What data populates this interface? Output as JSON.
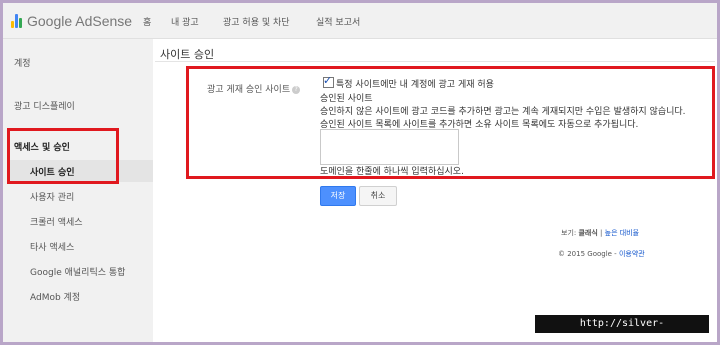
{
  "header": {
    "logo_text": "Google AdSense",
    "nav": [
      "홈",
      "내 광고",
      "광고 허용 및 차단",
      "실적 보고서"
    ]
  },
  "sidebar": {
    "items": [
      "계정",
      "광고 디스플레이",
      "액세스 및 승인",
      "사이트 승인",
      "사용자 관리",
      "크롤러 액세스",
      "타사 액세스",
      "Google 애널리틱스 통합",
      "AdMob 계정"
    ]
  },
  "main": {
    "section_title": "사이트 승인",
    "setting_label": "광고 게재 승인 사이트",
    "help_glyph": "?",
    "checkbox_label": "특정 사이트에만 내 계정에 광고 게재 허용",
    "approved_heading": "승인된 사이트",
    "desc_line1": "승인하지 않은 사이트에 광고 코드를 추가하면 광고는 계속 게재되지만 수입은 발생하지 않습니다.",
    "desc_line2": "승인된 사이트 목록에 사이트를 추가하면 소유 사이트 목록에도 자동으로 추가됩니다.",
    "textarea_value": "",
    "domain_hint": "도메인을 한줄에 하나씩 입력하십시오.",
    "save_label": "저장",
    "cancel_label": "취소"
  },
  "footer": {
    "view_label": "보기:",
    "classic": "클래식",
    "separator": "|",
    "high_contrast": "높은 대비율",
    "copyright": "© 2015 Google -",
    "terms": "이용약관"
  },
  "watermark": "http://silver-ship.tistory.com",
  "colors": {
    "highlight": "#e0181e",
    "primary_button": "#4d90fe",
    "sidebar_bg": "#f1f1f1"
  }
}
